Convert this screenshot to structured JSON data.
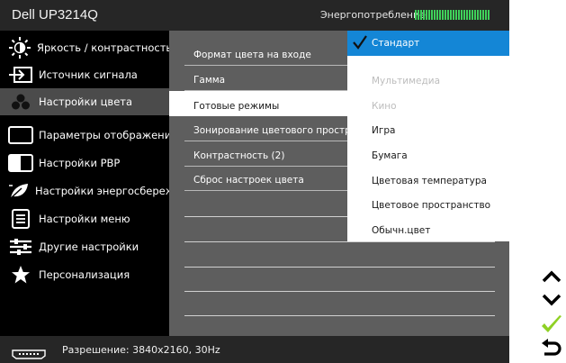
{
  "header": {
    "title": "Dell UP3214Q",
    "power_label": "Энергопотребление",
    "power_level": 1.0
  },
  "sidebar": {
    "items": [
      {
        "label": "Яркость / контрастность",
        "icon": "brightness-icon"
      },
      {
        "label": "Источник сигнала",
        "icon": "input-source-icon"
      },
      {
        "label": "Настройки цвета",
        "icon": "color-settings-icon",
        "active": true
      },
      {
        "label": "Параметры отображения",
        "icon": "display-icon"
      },
      {
        "label": "Настройки PBP",
        "icon": "pbp-icon"
      },
      {
        "label": "Настройки энергосбережения",
        "icon": "energy-leaf-icon"
      },
      {
        "label": "Настройки меню",
        "icon": "menu-icon"
      },
      {
        "label": "Другие настройки",
        "icon": "sliders-icon"
      },
      {
        "label": "Персонализация",
        "icon": "star-icon"
      }
    ]
  },
  "main": {
    "rows": [
      {
        "label": "Формат цвета на входе"
      },
      {
        "label": "Гамма"
      },
      {
        "label": "Готовые режимы",
        "selected": true
      },
      {
        "label": "Зонирование цветового простра"
      },
      {
        "label": "Контрастность (2)"
      },
      {
        "label": "Сброс настроек цвета"
      }
    ]
  },
  "dropdown": {
    "items": [
      {
        "label": "Стандарт",
        "state": "selected"
      },
      {
        "label": "Мультимедиа",
        "state": "disabled"
      },
      {
        "label": "Кино",
        "state": "disabled"
      },
      {
        "label": "Игра",
        "state": "normal"
      },
      {
        "label": "Бумага",
        "state": "normal"
      },
      {
        "label": "Цветовая температура",
        "state": "normal"
      },
      {
        "label": "Цветовое пространство",
        "state": "normal"
      },
      {
        "label": "Обычн.цвет",
        "state": "normal"
      }
    ]
  },
  "footer": {
    "resolution": "Разрешение: 3840x2160, 30Hz",
    "icon": "display-port-icon"
  },
  "buttons": [
    {
      "name": "up-button",
      "icon": "chevron-up-icon"
    },
    {
      "name": "down-button",
      "icon": "chevron-down-icon"
    },
    {
      "name": "confirm-button",
      "icon": "checkmark-icon"
    },
    {
      "name": "back-button",
      "icon": "back-arrow-icon"
    }
  ],
  "colors": {
    "osd_background": "#262626",
    "sidebar_background": "#000000",
    "main_background": "#5e5e5e",
    "highlight": "#1486d6",
    "power_bar": "#3fd15a",
    "confirm_green": "#8fd124"
  }
}
